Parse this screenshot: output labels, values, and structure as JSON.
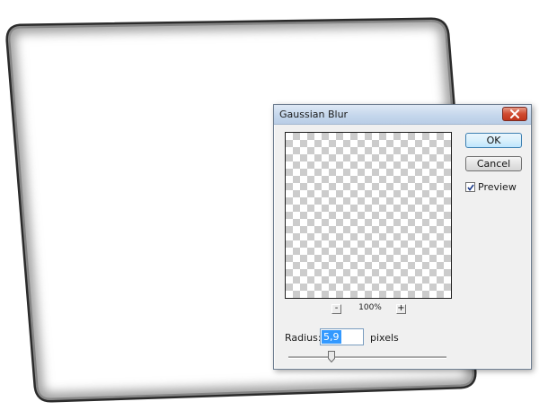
{
  "dialog": {
    "title": "Gaussian Blur",
    "close_icon": "close-icon",
    "ok_label": "OK",
    "cancel_label": "Cancel",
    "preview_label": "Preview",
    "preview_checked": true,
    "zoom_out_label": "-",
    "zoom_in_label": "+",
    "zoom_level": "100%",
    "radius_label": "Radius:",
    "radius_value": "5,9",
    "radius_unit": "pixels",
    "slider_position": 0.27
  },
  "colors": {
    "close_button": "#c8442a",
    "selection": "#3399ff",
    "title_bar": "#c5d7ec"
  }
}
